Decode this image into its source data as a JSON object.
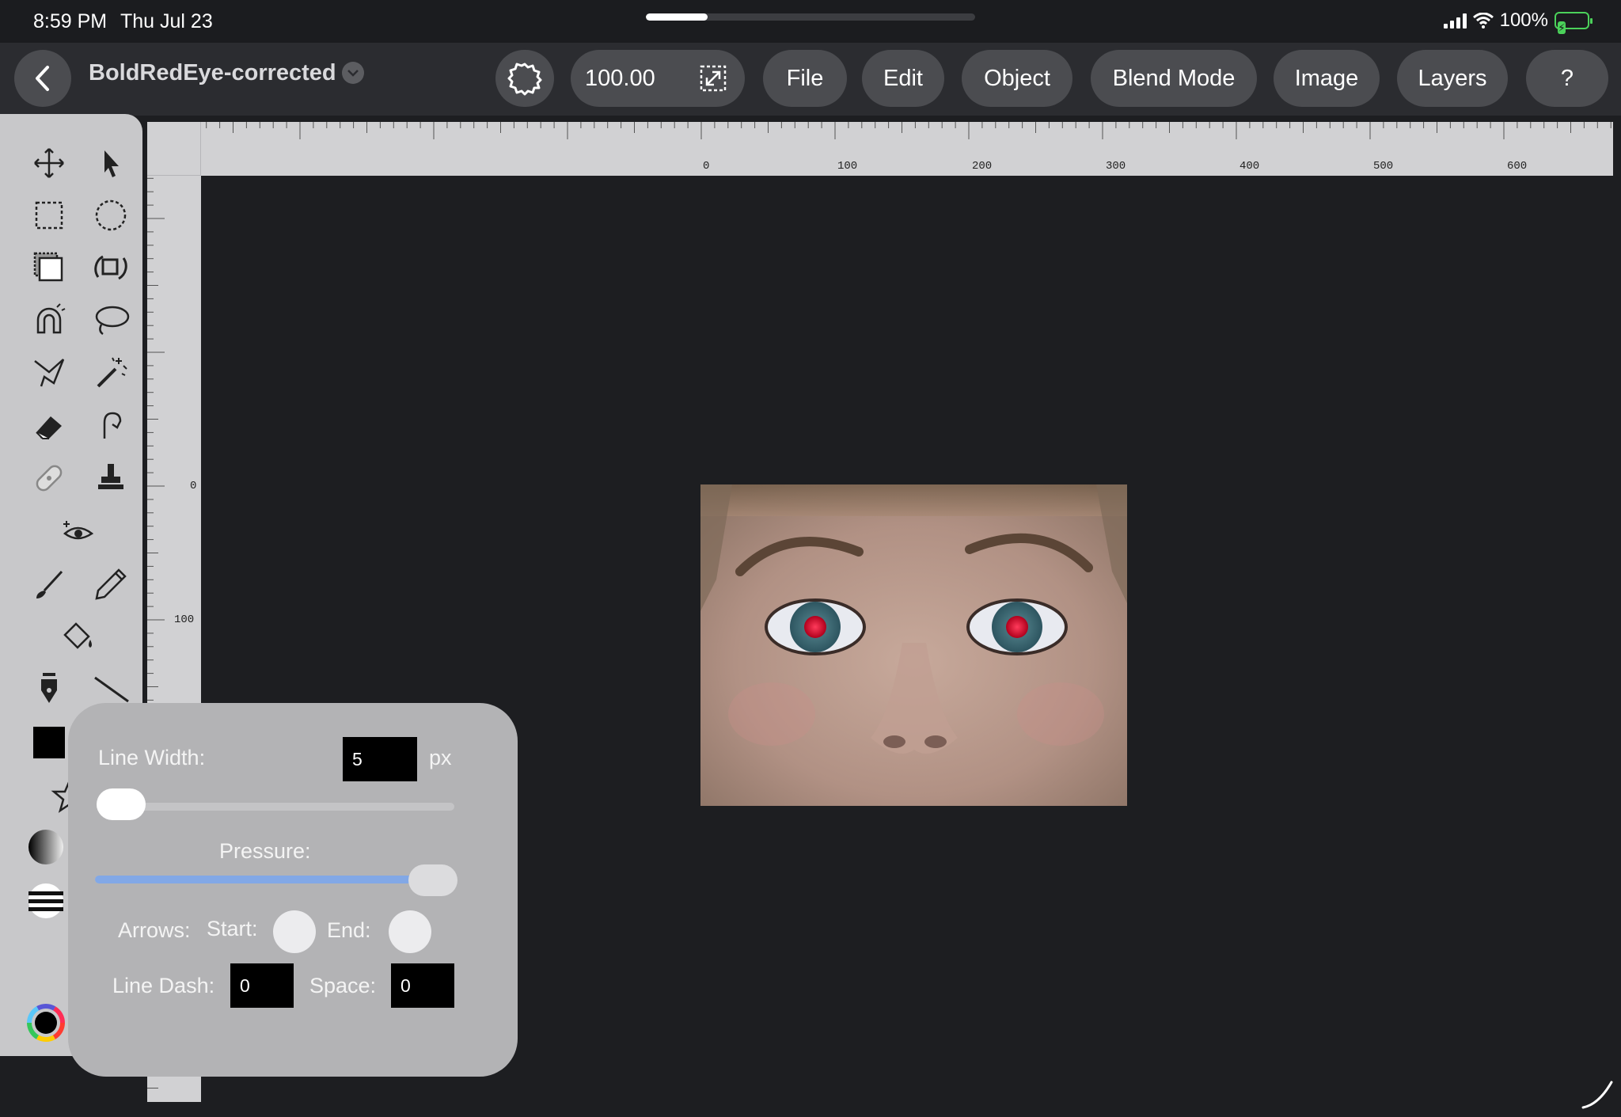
{
  "status_bar": {
    "time": "8:59 PM",
    "date": "Thu Jul 23",
    "battery": "100%"
  },
  "toolbar": {
    "back_icon": "chevron-left-icon",
    "document_title": "BoldRedEye-corrected",
    "zoom_value": "100.00",
    "menus": [
      "File",
      "Edit",
      "Object",
      "Blend Mode",
      "Image",
      "Layers",
      "?"
    ]
  },
  "tools": [
    "move-icon",
    "arrow-select-icon",
    "rect-select-icon",
    "ellipse-select-icon",
    "layers-select-icon",
    "transform-icon",
    "magnetic-lasso-icon",
    "lasso-icon",
    "polygon-lasso-icon",
    "magic-wand-icon",
    "eraser-icon",
    "smudge-icon",
    "bandage-icon",
    "stamp-icon",
    "red-eye-icon",
    "brush-icon",
    "pencil-icon",
    "paint-bucket-icon",
    "pen-icon",
    "line-icon",
    "color-swatch-icon",
    "shape-icon",
    "gradient-icon",
    "stripes-icon",
    "color-wheel-icon"
  ],
  "rulers": {
    "top_labels": [
      "0",
      "100",
      "200",
      "300",
      "400",
      "500",
      "600"
    ],
    "left_labels": [
      "0",
      "100"
    ]
  },
  "line_popover": {
    "line_width_label": "Line Width:",
    "line_width_value": "5",
    "line_width_unit": "px",
    "line_width_level": 0.01,
    "pressure_label": "Pressure:",
    "pressure_level": 1.0,
    "arrows_label": "Arrows:",
    "start_label": "Start:",
    "end_label": "End:",
    "line_dash_label": "Line Dash:",
    "line_dash_value": "0",
    "space_label": "Space:",
    "space_value": "0"
  },
  "colors": {
    "accent": "#82a8e6",
    "battery": "#4bd25a",
    "canvas_bg": "#1d1e21"
  }
}
